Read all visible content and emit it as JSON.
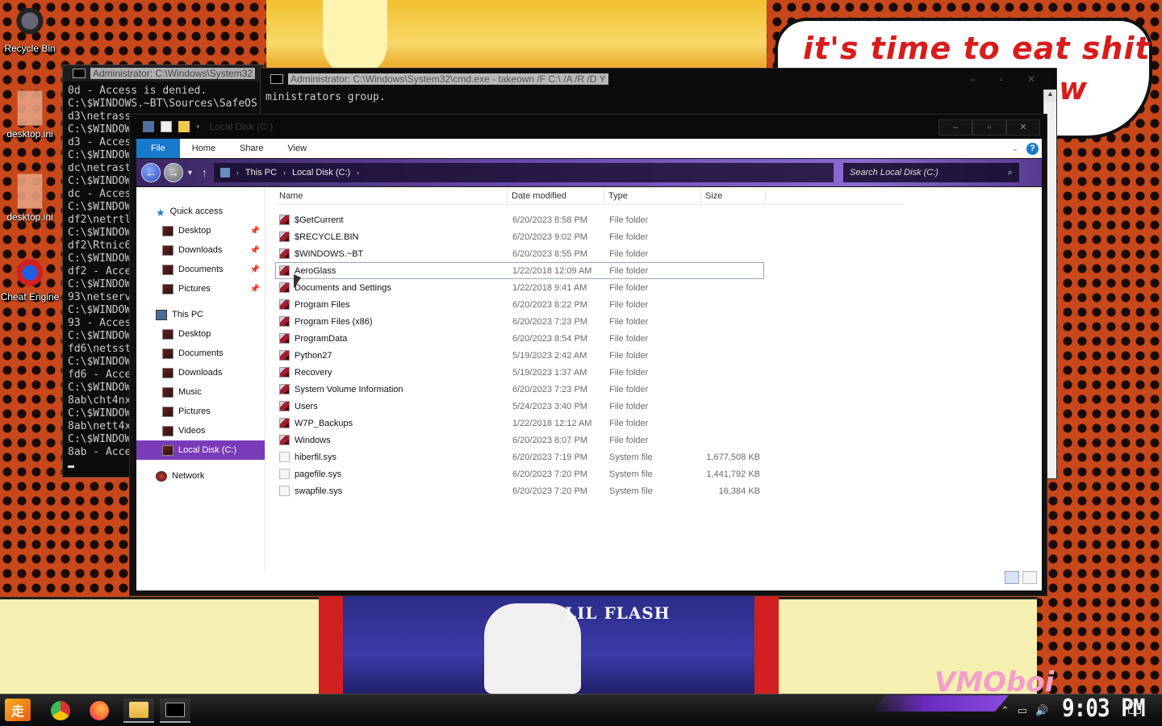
{
  "wallpaper": {
    "bubble_line1": "it's time to eat shit",
    "bubble_line2": "w",
    "poster_text": "LIL FLASH",
    "signature": "VMOboi"
  },
  "desktop_icons": [
    {
      "label": "Recycle Bin",
      "icon": "recycle-bin-icon"
    },
    {
      "label": "desktop.ini",
      "icon": "ini-file-icon"
    },
    {
      "label": "desktop.ini",
      "icon": "ini-file-icon"
    },
    {
      "label": "Cheat Engine",
      "icon": "cheat-engine-icon"
    }
  ],
  "cmd1": {
    "title": "Administrator: C:\\Windows\\System32",
    "lines": [
      "0d - Access is denied.",
      "C:\\$WINDOWS.~BT\\Sources\\SafeOS",
      "d3\\netrass",
      "C:\\$WINDOW",
      "d3 - Acces",
      "C:\\$WINDOW",
      "dc\\netrast",
      "C:\\$WINDOW",
      "dc - Acces",
      "C:\\$WINDOW",
      "df2\\netrtl",
      "C:\\$WINDOW",
      "df2\\Rtnic6",
      "C:\\$WINDOW",
      "df2 - Acce",
      "C:\\$WINDOW",
      "93\\netserv",
      "C:\\$WINDOW",
      "93 - Acces",
      "C:\\$WINDOW",
      "fd6\\netsst",
      "C:\\$WINDOW",
      "fd6 - Acce",
      "C:\\$WINDOW",
      "8ab\\cht4nx",
      "C:\\$WINDOW",
      "8ab\\nett4x",
      "C:\\$WINDOW",
      "8ab - Acce"
    ]
  },
  "cmd2": {
    "title": "Administrator: C:\\Windows\\System32\\cmd.exe - takeown  /F C:\\ /A /R /D Y",
    "lines": [
      "ministrators group."
    ]
  },
  "explorer": {
    "title": "Local Disk (C:)",
    "ribbon_tabs": [
      "File",
      "Home",
      "Share",
      "View"
    ],
    "breadcrumb": [
      "This PC",
      "Local Disk (C:)"
    ],
    "search_placeholder": "Search Local Disk (C:)",
    "columns": [
      "Name",
      "Date modified",
      "Type",
      "Size"
    ],
    "nav": [
      {
        "label": "Quick access",
        "icon": "star-icon",
        "level": "top",
        "pinned": false
      },
      {
        "label": "Desktop",
        "icon": "desktop-folder-icon",
        "level": "child",
        "pinned": true
      },
      {
        "label": "Downloads",
        "icon": "downloads-folder-icon",
        "level": "child",
        "pinned": true
      },
      {
        "label": "Documents",
        "icon": "documents-folder-icon",
        "level": "child",
        "pinned": true
      },
      {
        "label": "Pictures",
        "icon": "pictures-folder-icon",
        "level": "child",
        "pinned": true
      },
      {
        "label": "This PC",
        "icon": "this-pc-icon",
        "level": "top",
        "pinned": false
      },
      {
        "label": "Desktop",
        "icon": "desktop-folder-icon",
        "level": "child",
        "pinned": false
      },
      {
        "label": "Documents",
        "icon": "documents-folder-icon",
        "level": "child",
        "pinned": false
      },
      {
        "label": "Downloads",
        "icon": "downloads-folder-icon",
        "level": "child",
        "pinned": false
      },
      {
        "label": "Music",
        "icon": "music-folder-icon",
        "level": "child",
        "pinned": false
      },
      {
        "label": "Pictures",
        "icon": "pictures-folder-icon",
        "level": "child",
        "pinned": false
      },
      {
        "label": "Videos",
        "icon": "videos-folder-icon",
        "level": "child",
        "pinned": false
      },
      {
        "label": "Local Disk (C:)",
        "icon": "local-disk-icon",
        "level": "child",
        "pinned": false,
        "selected": true
      },
      {
        "label": "Network",
        "icon": "network-icon",
        "level": "top",
        "pinned": false
      }
    ],
    "files": [
      {
        "name": "$GetCurrent",
        "date": "6/20/2023 8:58 PM",
        "type": "File folder",
        "size": "",
        "kind": "folder"
      },
      {
        "name": "$RECYCLE.BIN",
        "date": "6/20/2023 9:02 PM",
        "type": "File folder",
        "size": "",
        "kind": "folder"
      },
      {
        "name": "$WINDOWS.~BT",
        "date": "6/20/2023 8:55 PM",
        "type": "File folder",
        "size": "",
        "kind": "folder"
      },
      {
        "name": "AeroGlass",
        "date": "1/22/2018 12:09 AM",
        "type": "File folder",
        "size": "",
        "kind": "folder",
        "highlighted": true
      },
      {
        "name": "Documents and Settings",
        "date": "1/22/2018 9:41 AM",
        "type": "File folder",
        "size": "",
        "kind": "folder"
      },
      {
        "name": "Program Files",
        "date": "6/20/2023 8:22 PM",
        "type": "File folder",
        "size": "",
        "kind": "folder"
      },
      {
        "name": "Program Files (x86)",
        "date": "6/20/2023 7:23 PM",
        "type": "File folder",
        "size": "",
        "kind": "folder"
      },
      {
        "name": "ProgramData",
        "date": "6/20/2023 8:54 PM",
        "type": "File folder",
        "size": "",
        "kind": "folder"
      },
      {
        "name": "Python27",
        "date": "5/19/2023 2:42 AM",
        "type": "File folder",
        "size": "",
        "kind": "folder"
      },
      {
        "name": "Recovery",
        "date": "5/19/2023 1:37 AM",
        "type": "File folder",
        "size": "",
        "kind": "folder"
      },
      {
        "name": "System Volume Information",
        "date": "6/20/2023 7:23 PM",
        "type": "File folder",
        "size": "",
        "kind": "folder"
      },
      {
        "name": "Users",
        "date": "5/24/2023 3:40 PM",
        "type": "File folder",
        "size": "",
        "kind": "folder"
      },
      {
        "name": "W7P_Backups",
        "date": "1/22/2018 12:12 AM",
        "type": "File folder",
        "size": "",
        "kind": "folder"
      },
      {
        "name": "Windows",
        "date": "6/20/2023 8:07 PM",
        "type": "File folder",
        "size": "",
        "kind": "folder"
      },
      {
        "name": "hiberfil.sys",
        "date": "6/20/2023 7:19 PM",
        "type": "System file",
        "size": "1,677,508 KB",
        "kind": "system"
      },
      {
        "name": "pagefile.sys",
        "date": "6/20/2023 7:20 PM",
        "type": "System file",
        "size": "1,441,792 KB",
        "kind": "system"
      },
      {
        "name": "swapfile.sys",
        "date": "6/20/2023 7:20 PM",
        "type": "System file",
        "size": "16,384 KB",
        "kind": "system"
      }
    ]
  },
  "taskbar": {
    "start_glyph": "走",
    "apps": [
      "chrome-icon",
      "firefox-icon",
      "file-explorer-icon",
      "cmd-icon"
    ],
    "clock": "9:03 PM"
  }
}
